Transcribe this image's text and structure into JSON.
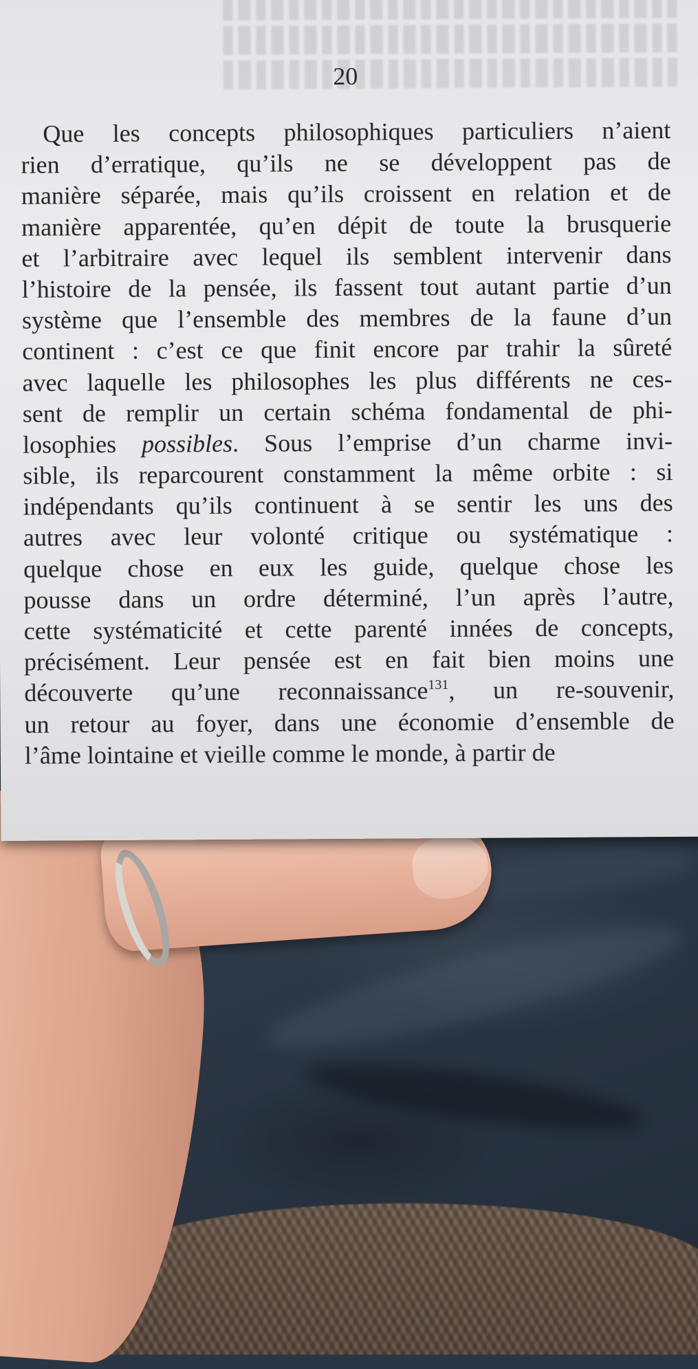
{
  "page": {
    "number": "20",
    "lines": [
      [
        "Que les concepts philosophiques particuliers n’aient"
      ],
      [
        "rien d’erratique, qu’ils ne se développent pas de"
      ],
      [
        "manière séparée, mais qu’ils croissent en relation et de"
      ],
      [
        "manière apparentée, qu’en dépit de toute la brusquerie"
      ],
      [
        "et l’arbitraire avec lequel ils semblent intervenir dans"
      ],
      [
        "l’histoire de la pensée, ils fassent tout autant partie d’un"
      ],
      [
        "système que l’ensemble des membres de la faune d’un"
      ],
      [
        "continent : c’est ce que finit encore par trahir la sûreté"
      ],
      [
        "avec laquelle les philosophes les plus différents ne ces-"
      ],
      [
        "sent de remplir un certain schéma fondamental de phi-"
      ],
      [
        "losophies ",
        "possibles",
        ". Sous l’emprise d’un charme invi-"
      ],
      [
        "sible, ils reparcourent constamment la même orbite : si"
      ],
      [
        "indépendants qu’ils continuent à se sentir les uns des"
      ],
      [
        "autres avec leur volonté critique ou systématique :"
      ],
      [
        "quelque chose en eux les guide, quelque chose les"
      ],
      [
        "pousse dans un ordre déterminé, l’un après l’autre,"
      ],
      [
        "cette systématicité et cette parenté innées de concepts,"
      ],
      [
        "précisément. Leur pensée est en fait bien moins une"
      ],
      [
        "découverte qu’une reconnaissance",
        "131",
        ", un re-souvenir,"
      ],
      [
        "un retour au foyer, dans une économie d’ensemble de"
      ],
      [
        "l’âme lointaine et vieille comme le monde, à partir de"
      ]
    ]
  }
}
